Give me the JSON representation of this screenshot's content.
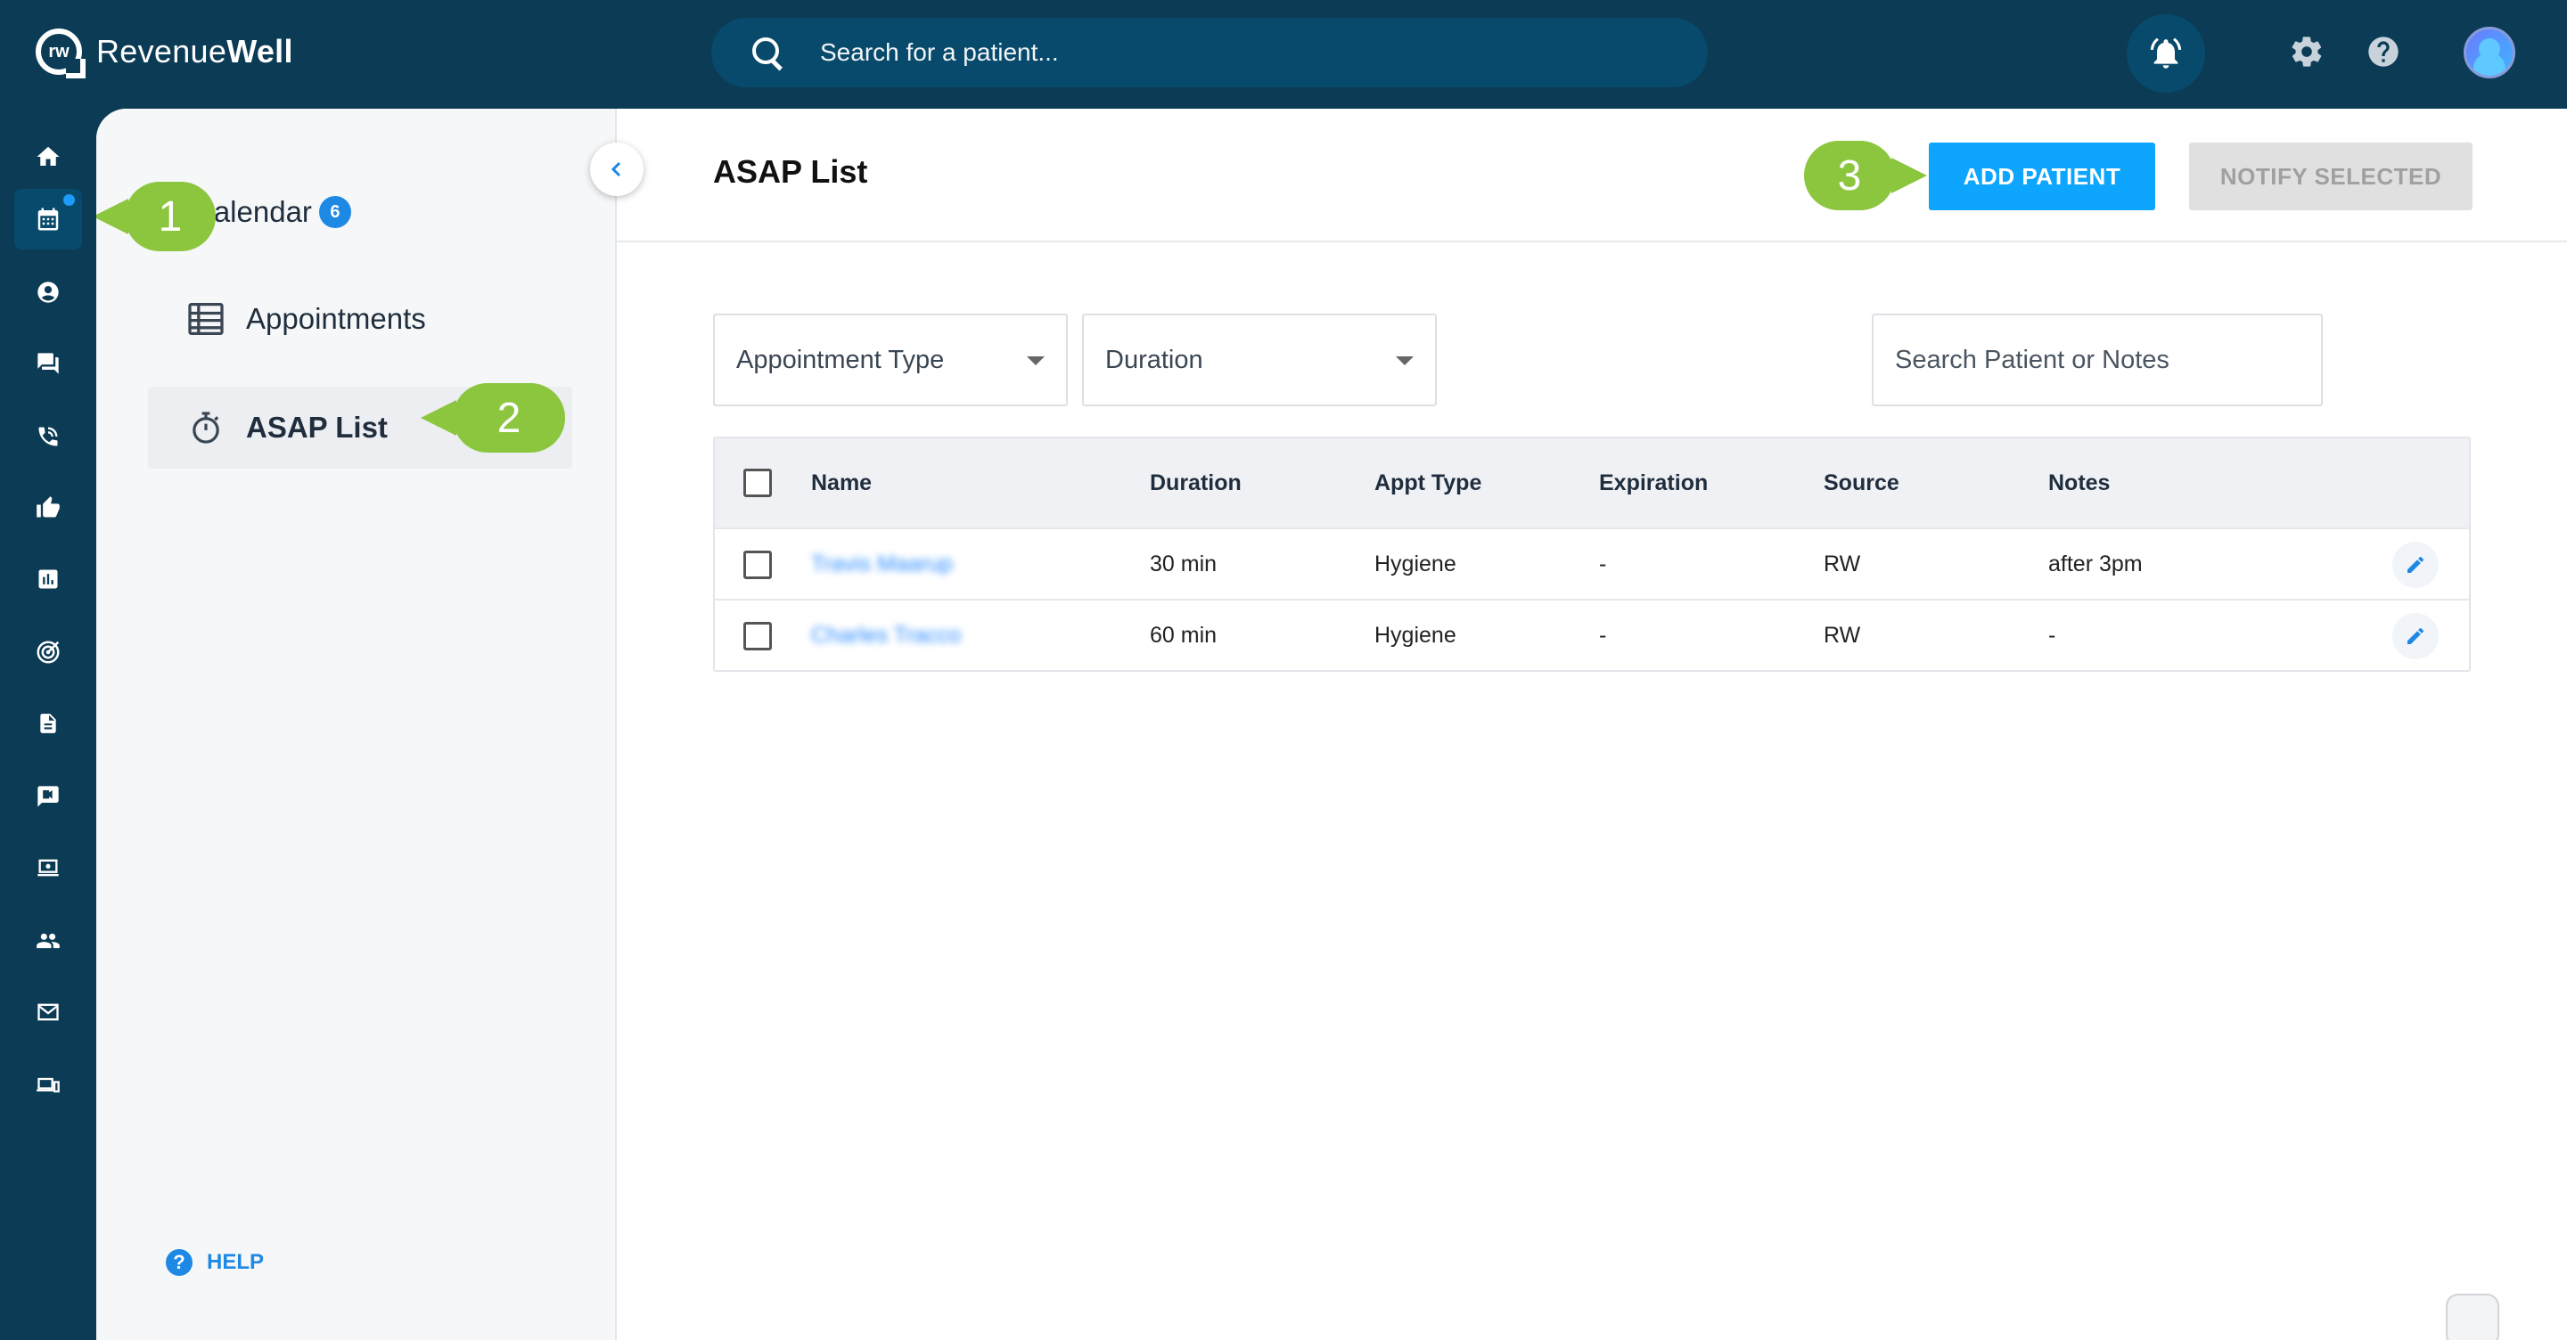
{
  "app": {
    "brand_prefix": "Revenue",
    "brand_suffix": "Well",
    "logo_text": "rw",
    "search_placeholder": "Search for a patient..."
  },
  "rail": {
    "items": [
      {
        "icon": "home-icon"
      },
      {
        "icon": "calendar-icon",
        "active": true,
        "dot": true
      },
      {
        "icon": "patient-icon"
      },
      {
        "icon": "chat-icon"
      },
      {
        "icon": "phone-icon"
      },
      {
        "icon": "thumbs-up-icon"
      },
      {
        "icon": "analytics-icon"
      },
      {
        "icon": "target-icon"
      },
      {
        "icon": "document-icon"
      },
      {
        "icon": "message-icon"
      },
      {
        "icon": "screen-icon"
      },
      {
        "icon": "group-icon"
      },
      {
        "icon": "mail-icon"
      },
      {
        "icon": "devices-icon"
      }
    ]
  },
  "subnav": {
    "calendar_label": "Calendar",
    "calendar_badge": "6",
    "appointments_label": "Appointments",
    "asap_label": "ASAP List",
    "help_label": "HELP",
    "help_icon_text": "?"
  },
  "callouts": {
    "one": "1",
    "two": "2",
    "three": "3"
  },
  "page": {
    "title": "ASAP List",
    "add_patient": "ADD PATIENT",
    "notify_selected": "NOTIFY SELECTED"
  },
  "filters": {
    "appointment_type": "Appointment Type",
    "duration": "Duration",
    "search_placeholder": "Search Patient or Notes"
  },
  "table": {
    "headers": {
      "name": "Name",
      "duration": "Duration",
      "appt_type": "Appt Type",
      "expiration": "Expiration",
      "source": "Source",
      "notes": "Notes"
    },
    "rows": [
      {
        "name": "Travis Maarup",
        "duration": "30 min",
        "appt_type": "Hygiene",
        "expiration": "-",
        "source": "RW",
        "notes": "after 3pm"
      },
      {
        "name": "Charles Tracco",
        "duration": "60 min",
        "appt_type": "Hygiene",
        "expiration": "-",
        "source": "RW",
        "notes": "-"
      }
    ]
  },
  "colors": {
    "nav_bg": "#0b3b55",
    "accent": "#0ea5ff",
    "callout": "#8cc63f"
  }
}
